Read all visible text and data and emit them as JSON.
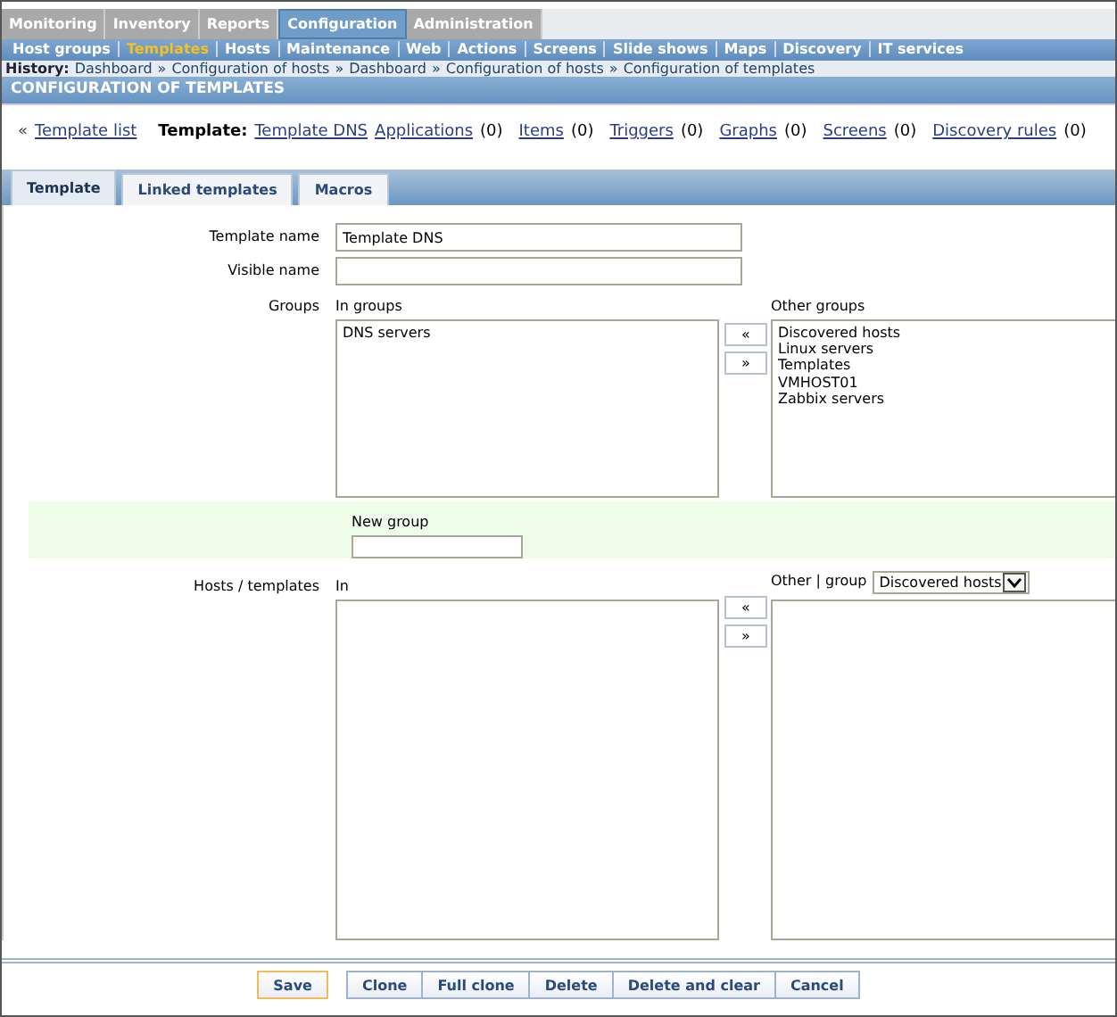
{
  "main_menu": [
    {
      "label": "Monitoring",
      "selected": false
    },
    {
      "label": "Inventory",
      "selected": false
    },
    {
      "label": "Reports",
      "selected": false
    },
    {
      "label": "Configuration",
      "selected": true
    },
    {
      "label": "Administration",
      "selected": false
    }
  ],
  "sub_menu": [
    {
      "label": "Host groups",
      "selected": false
    },
    {
      "label": "Templates",
      "selected": true
    },
    {
      "label": "Hosts",
      "selected": false
    },
    {
      "label": "Maintenance",
      "selected": false
    },
    {
      "label": "Web",
      "selected": false
    },
    {
      "label": "Actions",
      "selected": false
    },
    {
      "label": "Screens",
      "selected": false
    },
    {
      "label": "Slide shows",
      "selected": false
    },
    {
      "label": "Maps",
      "selected": false
    },
    {
      "label": "Discovery",
      "selected": false
    },
    {
      "label": "IT services",
      "selected": false
    }
  ],
  "history": {
    "label": "History:",
    "items": [
      "Dashboard",
      "Configuration of hosts",
      "Dashboard",
      "Configuration of hosts",
      "Configuration of templates"
    ],
    "separator": "»"
  },
  "page_title": "CONFIGURATION OF TEMPLATES",
  "nav": {
    "back_mark": "«",
    "back_link": "Template list",
    "template_label": "Template:",
    "template_link": "Template DNS",
    "links": [
      {
        "label": "Applications",
        "count": "(0)"
      },
      {
        "label": "Items",
        "count": "(0)"
      },
      {
        "label": "Triggers",
        "count": "(0)"
      },
      {
        "label": "Graphs",
        "count": "(0)"
      },
      {
        "label": "Screens",
        "count": "(0)"
      },
      {
        "label": "Discovery rules",
        "count": "(0)"
      }
    ]
  },
  "tabs": [
    {
      "label": "Template",
      "selected": true
    },
    {
      "label": "Linked templates",
      "selected": false
    },
    {
      "label": "Macros",
      "selected": false
    }
  ],
  "form": {
    "template_name": {
      "label": "Template name",
      "value": "Template DNS"
    },
    "visible_name": {
      "label": "Visible name"
    },
    "groups": {
      "label": "Groups",
      "in_label": "In groups",
      "in_items": [
        "DNS servers"
      ],
      "other_label": "Other groups",
      "other_items": [
        "Discovered hosts",
        "Linux servers",
        "Templates",
        "VMHOST01",
        "Zabbix servers"
      ],
      "move_left": "«",
      "move_right": "»"
    },
    "new_group": {
      "label": "New group"
    },
    "hosts": {
      "label": "Hosts / templates",
      "in_label": "In",
      "other_label": "Other | group",
      "group_select": "Discovered hosts",
      "move_left": "«",
      "move_right": "»"
    }
  },
  "buttons": [
    {
      "label": "Save",
      "kind": "primary"
    },
    {
      "label": "Clone",
      "kind": "normal"
    },
    {
      "label": "Full clone",
      "kind": "normal"
    },
    {
      "label": "Delete",
      "kind": "normal"
    },
    {
      "label": "Delete and clear",
      "kind": "normal"
    },
    {
      "label": "Cancel",
      "kind": "normal"
    }
  ]
}
